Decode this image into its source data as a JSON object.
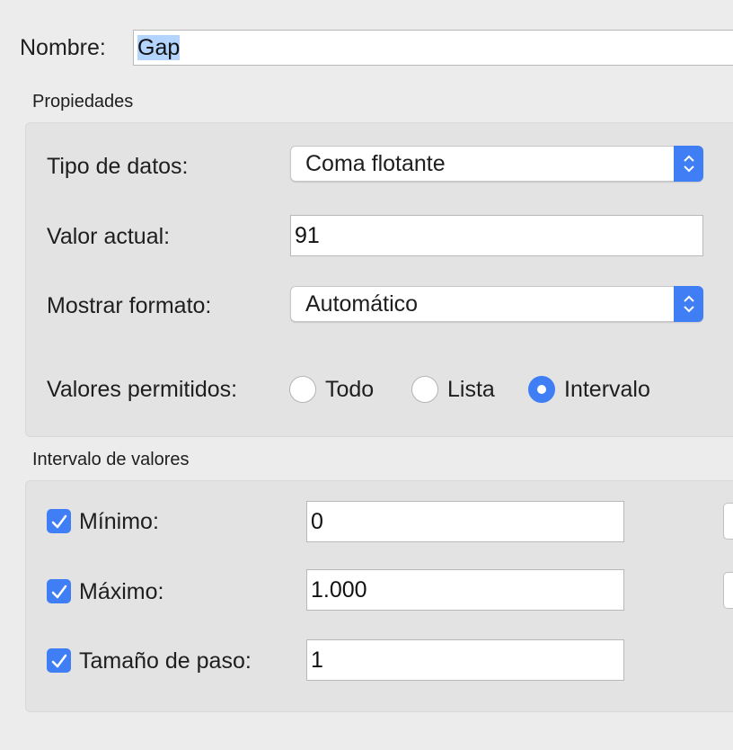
{
  "name": {
    "label": "Nombre:",
    "value": "Gap"
  },
  "properties": {
    "title": "Propiedades",
    "data_type": {
      "label": "Tipo de datos:",
      "value": "Coma flotante"
    },
    "current_value": {
      "label": "Valor actual:",
      "value": "91"
    },
    "display_format": {
      "label": "Mostrar formato:",
      "value": "Automático"
    },
    "allowed_values": {
      "label": "Valores permitidos:",
      "options": [
        "Todo",
        "Lista",
        "Intervalo"
      ],
      "selected": "Intervalo"
    }
  },
  "range": {
    "title": "Intervalo de valores",
    "minimum": {
      "label": "Mínimo:",
      "checked": true,
      "value": "0"
    },
    "maximum": {
      "label": "Máximo:",
      "checked": true,
      "value": "1.000"
    },
    "step": {
      "label": "Tamaño de paso:",
      "checked": true,
      "value": "1"
    }
  },
  "colors": {
    "accent": "#3f7ef5",
    "selection": "#b3d4fd",
    "panel": "#e3e3e3",
    "window": "#ececec"
  }
}
